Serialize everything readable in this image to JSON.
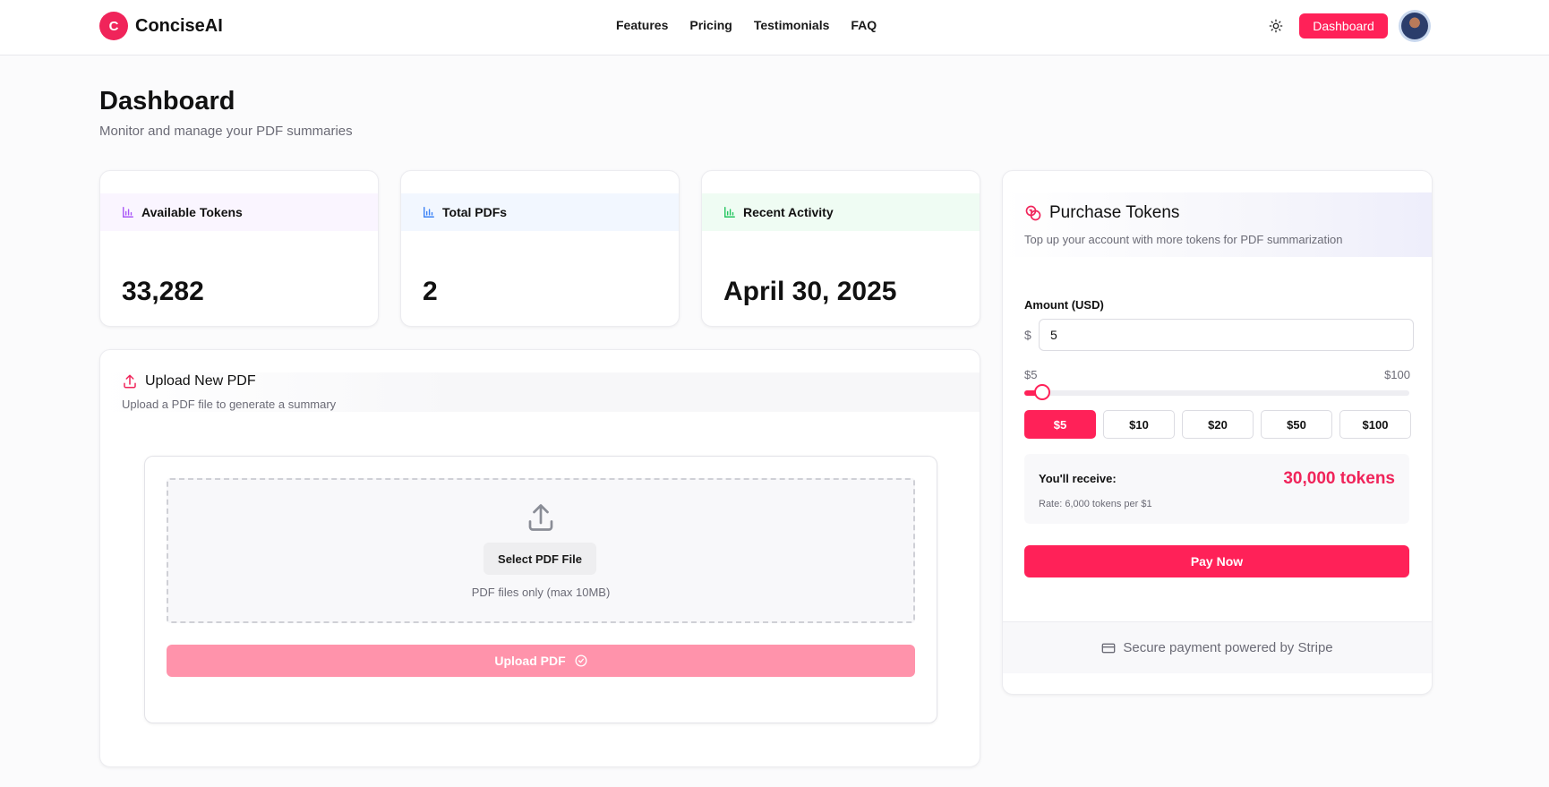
{
  "header": {
    "logo_letter": "C",
    "app_name": "ConciseAI",
    "nav": [
      "Features",
      "Pricing",
      "Testimonials",
      "FAQ"
    ],
    "theme_icon": "sun-icon",
    "dashboard_button": "Dashboard"
  },
  "page": {
    "title": "Dashboard",
    "subtitle": "Monitor and manage your PDF summaries"
  },
  "stats": [
    {
      "label": "Available Tokens",
      "value": "33,282",
      "icon": "bar-chart-icon",
      "color": "#a855f7",
      "band": "#faf5ff"
    },
    {
      "label": "Total PDFs",
      "value": "2",
      "icon": "bar-chart-icon",
      "color": "#3b82f6",
      "band": "#f2f7ff"
    },
    {
      "label": "Recent Activity",
      "value": "April 30, 2025",
      "icon": "bar-chart-icon",
      "color": "#22c55e",
      "band": "#effcf3"
    }
  ],
  "upload": {
    "title": "Upload New PDF",
    "subtitle": "Upload a PDF file to generate a summary",
    "select_button": "Select PDF File",
    "note": "PDF files only (max 10MB)",
    "upload_button": "Upload PDF"
  },
  "purchase": {
    "title": "Purchase Tokens",
    "subtitle": "Top up your account with more tokens for PDF summarization",
    "amount_label": "Amount (USD)",
    "currency_symbol": "$",
    "amount_value": "5",
    "range_min": "$5",
    "range_max": "$100",
    "slider_value": 5,
    "slider_min": 5,
    "slider_max": 100,
    "presets": [
      "$5",
      "$10",
      "$20",
      "$50",
      "$100"
    ],
    "active_preset": "$5",
    "receive_label": "You'll receive:",
    "receive_value": "30,000 tokens",
    "rate": "Rate: 6,000 tokens per $1",
    "pay_button": "Pay Now",
    "footer": "Secure payment powered by Stripe"
  },
  "colors": {
    "accent": "#ff2158",
    "accent_light": "#ff93ab"
  }
}
